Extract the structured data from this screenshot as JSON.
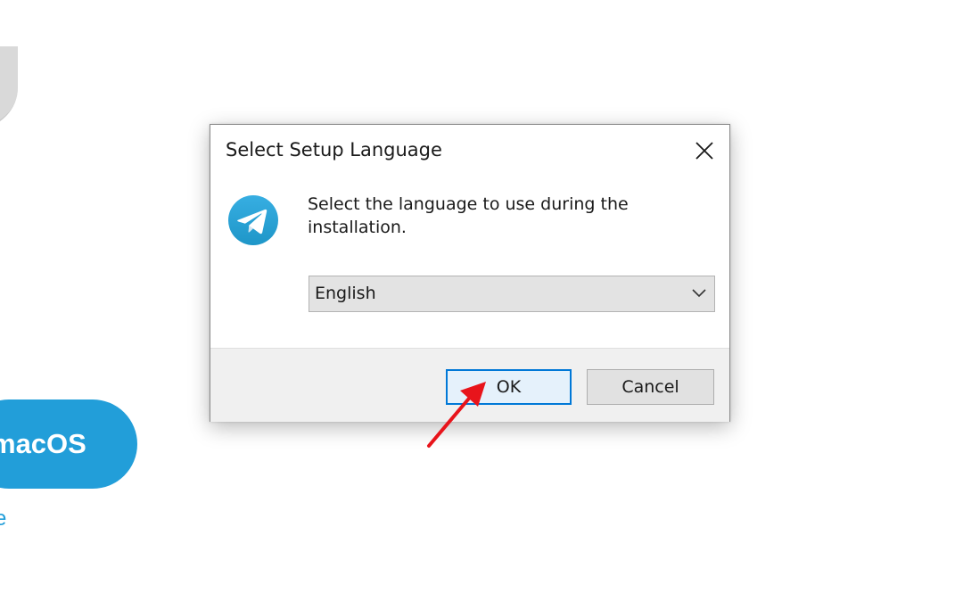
{
  "background": {
    "download_button_label": "macOS",
    "link_fragment": "e"
  },
  "dialog": {
    "title": "Select Setup Language",
    "message": "Select the language to use during the installation.",
    "language_select": {
      "selected": "English"
    },
    "buttons": {
      "ok": "OK",
      "cancel": "Cancel"
    }
  },
  "icons": {
    "app": "telegram-icon",
    "close": "close-icon",
    "dropdown": "chevron-down-icon",
    "annotation": "red-arrow-icon"
  },
  "colors": {
    "accent": "#0078d7",
    "brand": "#229ed9",
    "annotation": "#e8141b"
  }
}
